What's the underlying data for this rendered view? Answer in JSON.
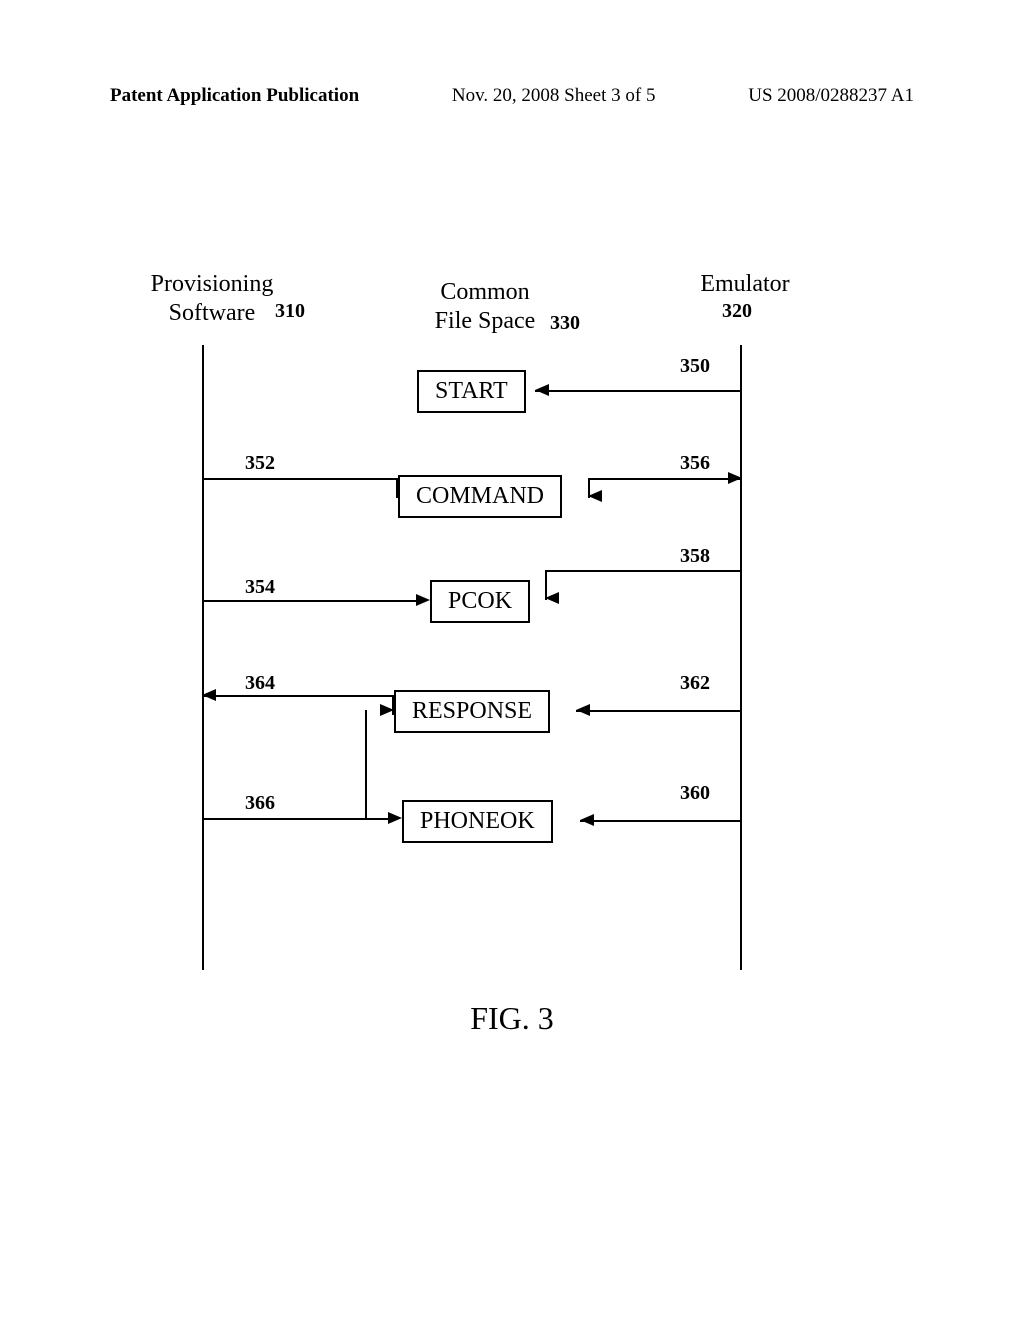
{
  "header": {
    "left": "Patent Application Publication",
    "center": "Nov. 20, 2008  Sheet 3 of 5",
    "right": "US 2008/0288237 A1"
  },
  "labels": {
    "provisioning": "Provisioning\nSoftware",
    "provisioning_num": "310",
    "common": "Common\nFile Space",
    "common_num": "330",
    "emulator": "Emulator",
    "emulator_num": "320"
  },
  "boxes": {
    "start": "START",
    "command": "COMMAND",
    "pcok": "PCOK",
    "response": "RESPONSE",
    "phoneok": "PHONEOK"
  },
  "nums": {
    "n350": "350",
    "n352": "352",
    "n354": "354",
    "n356": "356",
    "n358": "358",
    "n360": "360",
    "n362": "362",
    "n364": "364",
    "n366": "366"
  },
  "figure": "FIG. 3"
}
